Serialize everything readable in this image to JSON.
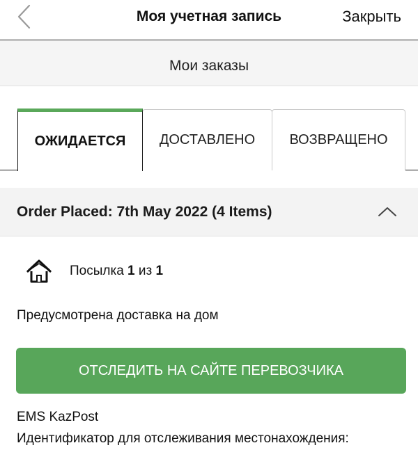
{
  "header": {
    "title": "Моя учетная запись",
    "close_label": "Закрыть",
    "back_icon": "chevron-left-icon"
  },
  "subheader": {
    "title": "Мои заказы"
  },
  "tabs": [
    {
      "label": "ОЖИДАЕТСЯ",
      "active": true
    },
    {
      "label": "ДОСТАВЛЕНО",
      "active": false
    },
    {
      "label": "ВОЗВРАЩЕНО",
      "active": false
    }
  ],
  "order": {
    "title": "Order Placed: 7th May 2022 (4 Items)",
    "expanded": true,
    "parcel": {
      "prefix": "Посылка",
      "index": "1",
      "of": "из",
      "total": "1",
      "icon": "house-icon"
    },
    "delivery_note": "Предусмотрена доставка на дом",
    "track_button_label": "ОТСЛЕДИТЬ НА САЙТЕ ПЕРЕВОЗЧИКА",
    "carrier": "EMS KazPost",
    "tracking_label": "Идентификатор для отслеживания местонахождения:"
  },
  "colors": {
    "accent_green": "#58a65a",
    "active_tab_bar": "#5aa85a",
    "section_bg": "#f3f3f3"
  }
}
